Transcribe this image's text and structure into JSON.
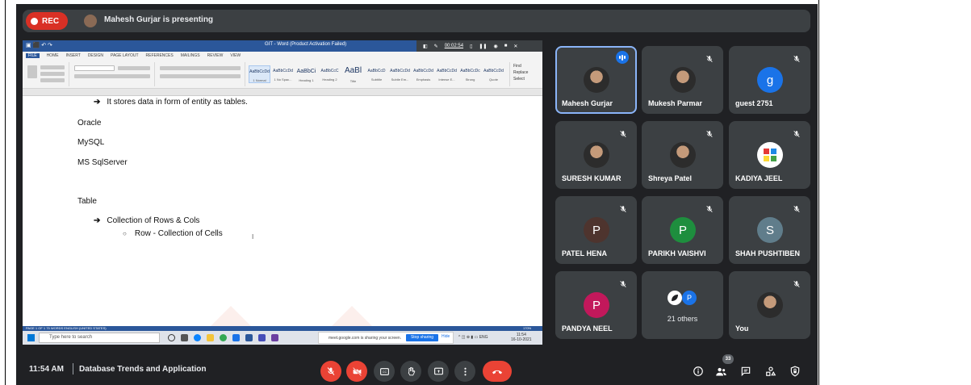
{
  "recording": {
    "label": "REC"
  },
  "presenter_banner": {
    "text": "Mahesh Gurjar is presenting"
  },
  "word": {
    "window_title": "GIT - Word (Product Activation Failed)",
    "timer": "00:02:54",
    "tabs": [
      "FILE",
      "HOME",
      "INSERT",
      "DESIGN",
      "PAGE LAYOUT",
      "REFERENCES",
      "MAILINGS",
      "REVIEW",
      "VIEW"
    ],
    "styles": [
      {
        "preview": "AaBbCcDd",
        "name": "1 Normal"
      },
      {
        "preview": "AaBbCcDd",
        "name": "1 No Spac..."
      },
      {
        "preview": "AaBbCi",
        "name": "Heading 1"
      },
      {
        "preview": "AaBbCcC",
        "name": "Heading 2"
      },
      {
        "preview": "AaBl",
        "name": "Title"
      },
      {
        "preview": "AaBbCcD",
        "name": "Subtitle"
      },
      {
        "preview": "AaBbCcDd",
        "name": "Subtle Em..."
      },
      {
        "preview": "AaBbCcDd",
        "name": "Emphasis"
      },
      {
        "preview": "AaBbCcDd",
        "name": "Intense E..."
      },
      {
        "preview": "AaBbCcDc",
        "name": "Strong"
      },
      {
        "preview": "AaBbCcDd",
        "name": "Quote"
      }
    ],
    "editing": {
      "find": "Find",
      "replace": "Replace",
      "select": "Select"
    },
    "document": {
      "line1": "It stores data in form of entity as tables.",
      "line2": "Oracle",
      "line3": "MySQL",
      "line4": "MS SqlServer",
      "line5": "Table",
      "line6": "Collection of Rows & Cols",
      "line7": "Row - Collection of Cells"
    },
    "status": "PAGE 1 OF 1   75 WORDS   ENGLISH (UNITED STATES)",
    "zoom": "170%"
  },
  "taskbar": {
    "search_placeholder": "Type here to search",
    "share_text": "meet.google.com is sharing your screen.",
    "stop_label": "Stop sharing",
    "hide_label": "Hide",
    "lang": "ENG",
    "clock_time": "11:54",
    "clock_date": "16-10-2021"
  },
  "participants": [
    {
      "name": "Mahesh Gurjar",
      "avatar": "photo",
      "speaking": true
    },
    {
      "name": "Mukesh Parmar",
      "avatar": "photo",
      "muted": true
    },
    {
      "name": "guest 2751",
      "avatar": "g",
      "color": "#1a73e8",
      "muted": true
    },
    {
      "name": "SURESH KUMAR",
      "avatar": "photo",
      "muted": true
    },
    {
      "name": "Shreya Patel",
      "avatar": "photo",
      "muted": true
    },
    {
      "name": "KADIYA JEEL",
      "avatar": "logo",
      "muted": true
    },
    {
      "name": "PATEL HENA",
      "avatar": "P",
      "color": "#4e342e",
      "muted": true
    },
    {
      "name": "PARIKH VAISHVI",
      "avatar": "P",
      "color": "#1e8e3e",
      "muted": true
    },
    {
      "name": "SHAH PUSHTIBEN",
      "avatar": "S",
      "color": "#607d8b",
      "muted": true
    },
    {
      "name": "PANDYA NEEL",
      "avatar": "P",
      "color": "#c2185b",
      "muted": true
    },
    {
      "name": "21 others",
      "avatar": "group"
    },
    {
      "name": "You",
      "avatar": "photo",
      "muted": true
    }
  ],
  "others_avatar_letter": "P",
  "bottom": {
    "time": "11:54 AM",
    "meeting_title": "Database Trends and Application",
    "participant_count": "33"
  },
  "colors": {
    "meet_bg": "#202124",
    "tile_bg": "#3c4043",
    "red": "#ea4335",
    "blue": "#1a73e8"
  }
}
